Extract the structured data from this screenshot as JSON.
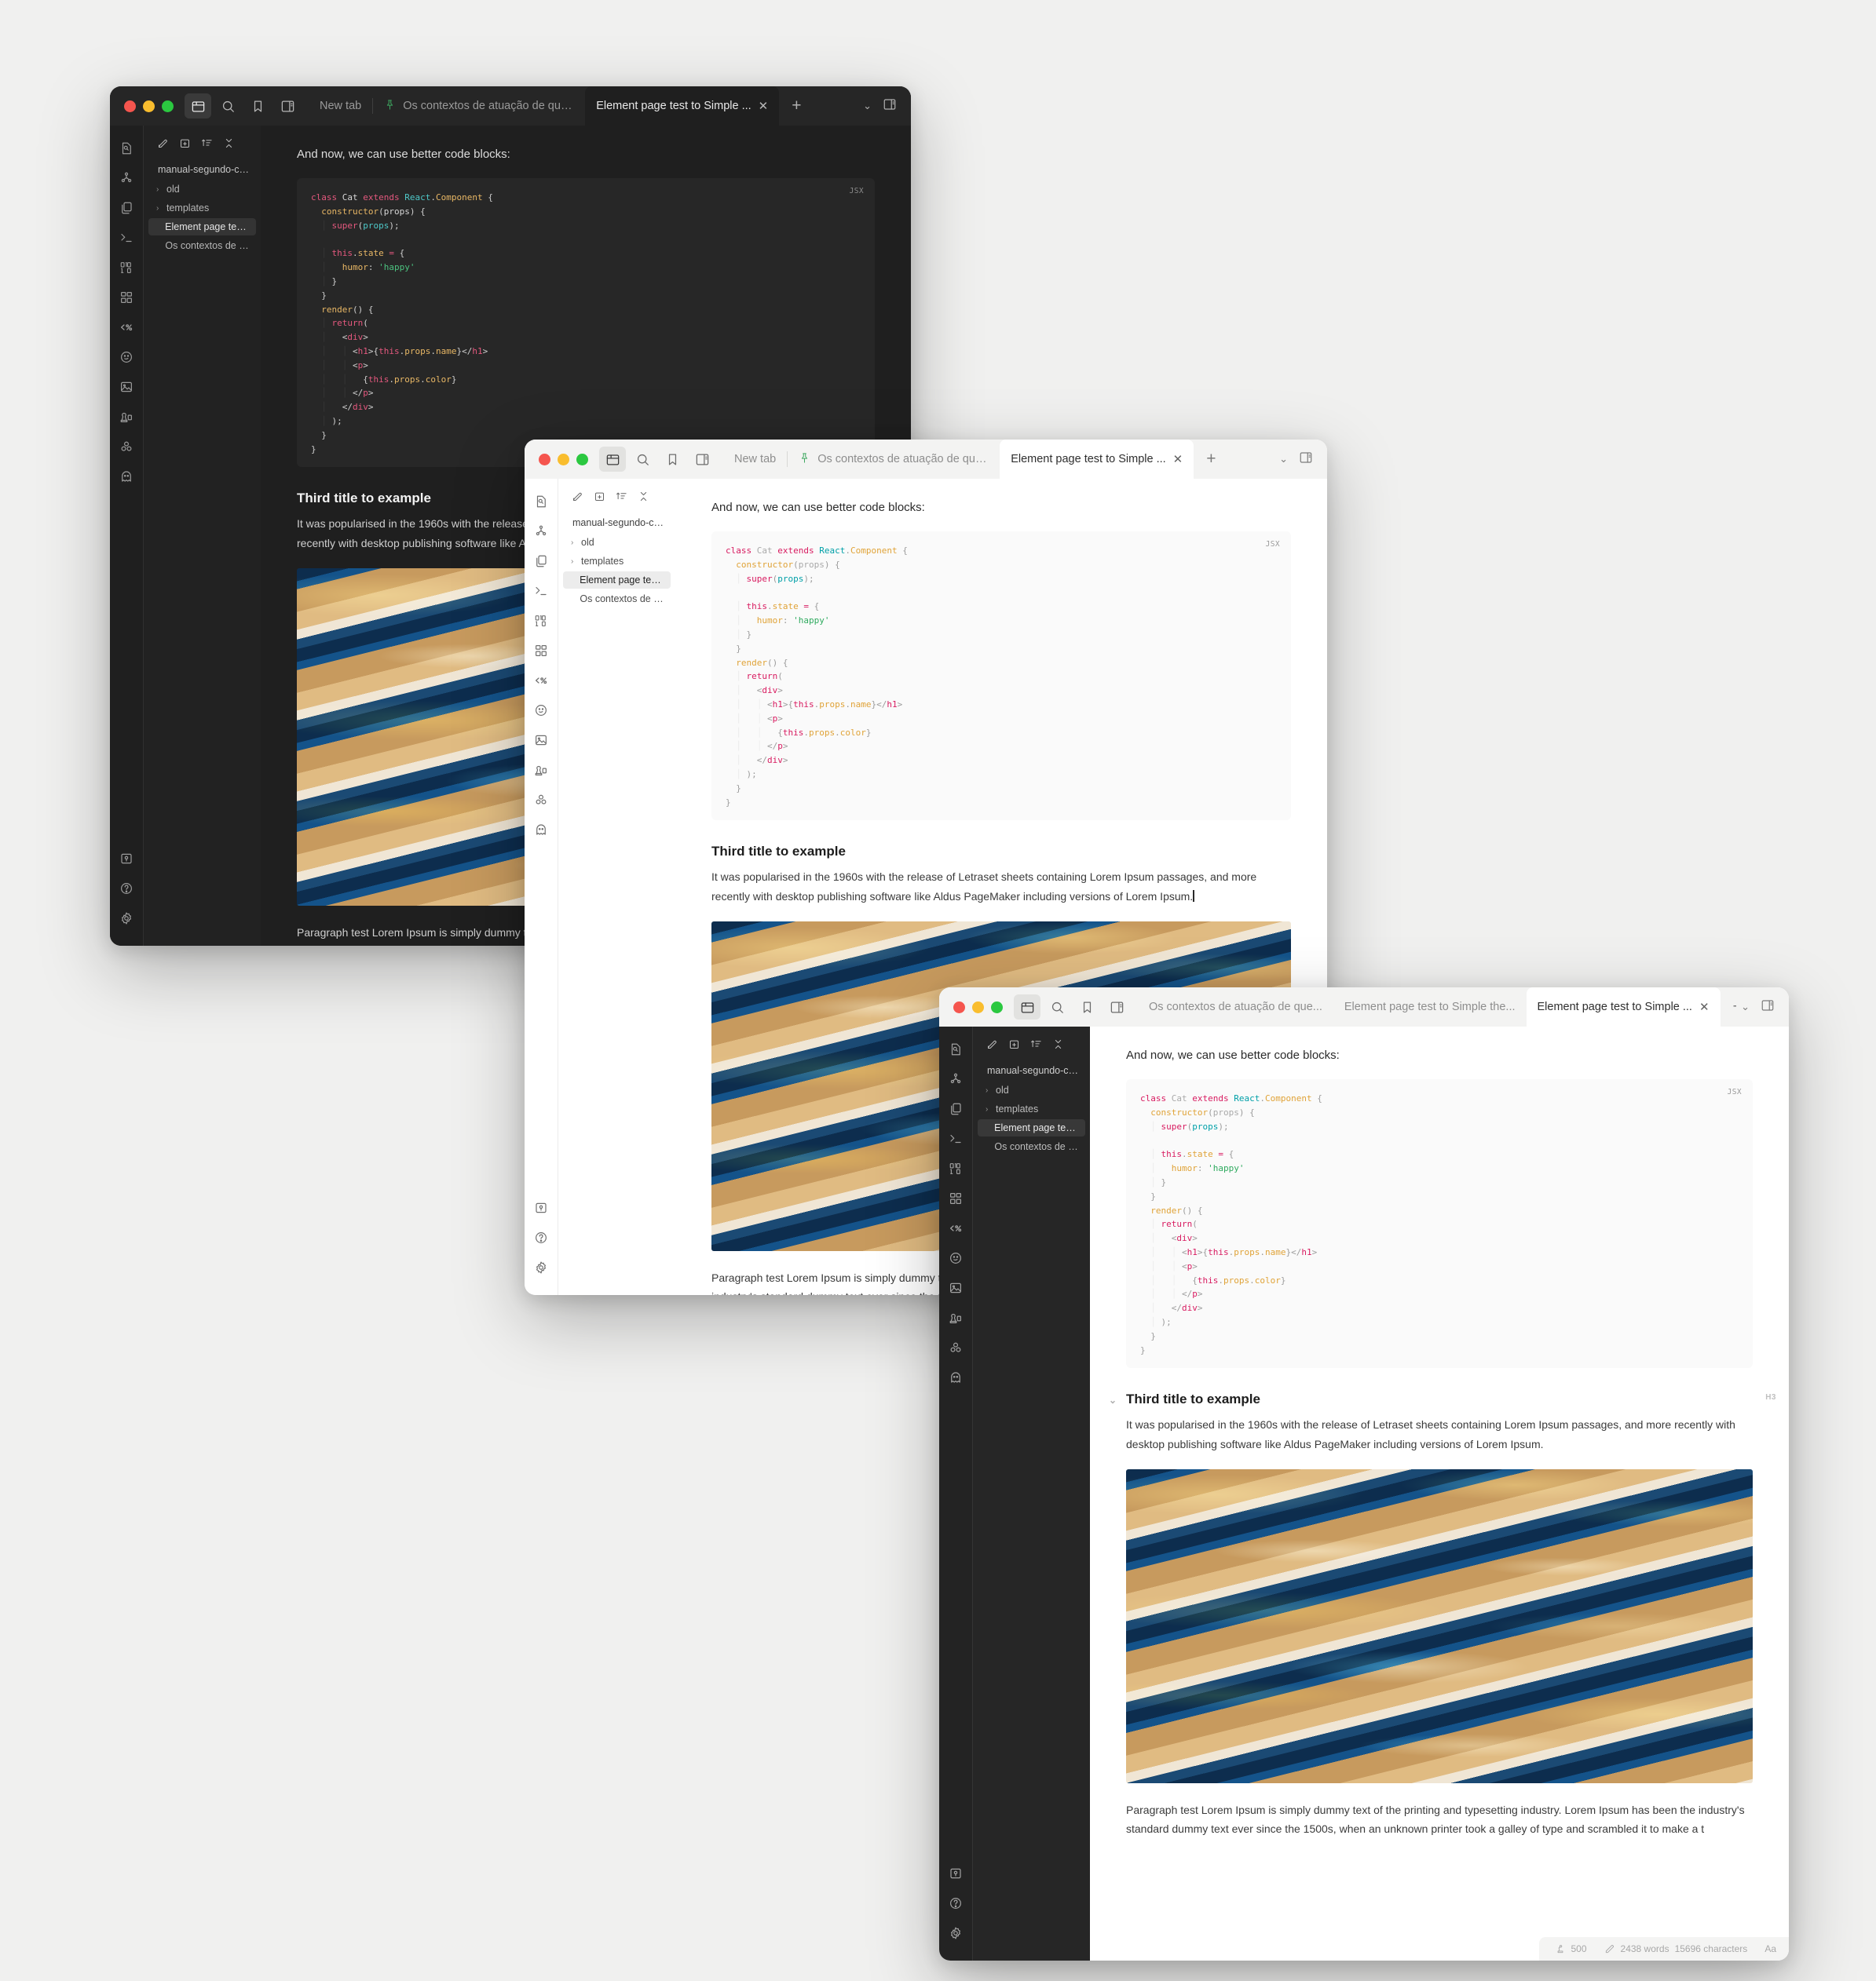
{
  "app": {
    "code_lang_badge": "JSX",
    "intro_text": "And now, we can use better code blocks:",
    "heading": "Third title to example",
    "paragraph_1": "It was popularised in the 1960s with the release of Letraset sheets containing Lorem Ipsum passages, and more recently with desktop publishing software like Aldus PageMaker including versions of Lorem Ipsum.",
    "paragraph_2": "Paragraph test Lorem Ipsum is simply dummy text of the printing and typesetting industry. Lorem Ipsum has been the industry's standard dummy text ever since the 1500s, when an unknown printer took a galley of type and scrambled it to make a t",
    "heading_tag": "H3"
  },
  "code": {
    "lines": [
      [
        {
          "t": "class ",
          "c": "t-kw"
        },
        {
          "t": "Cat ",
          "c": "t-cls"
        },
        {
          "t": "extends ",
          "c": "t-kw"
        },
        {
          "t": "React",
          "c": "t-typ"
        },
        {
          "t": ".",
          "c": "t-pl"
        },
        {
          "t": "Component",
          "c": "t-prop"
        },
        {
          "t": " {",
          "c": "t-pl"
        }
      ],
      [
        {
          "t": "  ",
          "c": "t-pl"
        },
        {
          "t": "constructor",
          "c": "t-fn"
        },
        {
          "t": "(",
          "c": "t-pl"
        },
        {
          "t": "props",
          "c": "t-cls"
        },
        {
          "t": ") {",
          "c": "t-pl"
        }
      ],
      [
        {
          "t": "  ",
          "c": "t-pl"
        },
        {
          "t": "│",
          "c": "gb"
        },
        {
          "t": " ",
          "c": "t-pl"
        },
        {
          "t": "super",
          "c": "t-kw"
        },
        {
          "t": "(",
          "c": "t-pl"
        },
        {
          "t": "props",
          "c": "t-var"
        },
        {
          "t": ");",
          "c": "t-pl"
        }
      ],
      [
        {
          "t": "",
          "c": "t-pl"
        }
      ],
      [
        {
          "t": "  ",
          "c": "t-pl"
        },
        {
          "t": "│",
          "c": "gb"
        },
        {
          "t": " ",
          "c": "t-pl"
        },
        {
          "t": "this",
          "c": "t-kw"
        },
        {
          "t": ".",
          "c": "t-pl"
        },
        {
          "t": "state",
          "c": "t-prop"
        },
        {
          "t": " ",
          "c": "t-pl"
        },
        {
          "t": "=",
          "c": "t-kw"
        },
        {
          "t": " {",
          "c": "t-pl"
        }
      ],
      [
        {
          "t": "  ",
          "c": "t-pl"
        },
        {
          "t": "│",
          "c": "gb"
        },
        {
          "t": "   ",
          "c": "t-pl"
        },
        {
          "t": "humor",
          "c": "t-prop"
        },
        {
          "t": ": ",
          "c": "t-pl"
        },
        {
          "t": "'happy'",
          "c": "t-str"
        }
      ],
      [
        {
          "t": "  ",
          "c": "t-pl"
        },
        {
          "t": "│",
          "c": "gb"
        },
        {
          "t": " }",
          "c": "t-pl"
        }
      ],
      [
        {
          "t": "  }",
          "c": "t-pl"
        }
      ],
      [
        {
          "t": "  ",
          "c": "t-pl"
        },
        {
          "t": "render",
          "c": "t-fn"
        },
        {
          "t": "() {",
          "c": "t-pl"
        }
      ],
      [
        {
          "t": "  ",
          "c": "t-pl"
        },
        {
          "t": "│",
          "c": "gb"
        },
        {
          "t": " ",
          "c": "t-pl"
        },
        {
          "t": "return",
          "c": "t-kw"
        },
        {
          "t": "(",
          "c": "t-pl"
        }
      ],
      [
        {
          "t": "  ",
          "c": "t-pl"
        },
        {
          "t": "│",
          "c": "gb"
        },
        {
          "t": "   <",
          "c": "t-pl"
        },
        {
          "t": "div",
          "c": "t-tag"
        },
        {
          "t": ">",
          "c": "t-pl"
        }
      ],
      [
        {
          "t": "  ",
          "c": "t-pl"
        },
        {
          "t": "│",
          "c": "gb"
        },
        {
          "t": "   ",
          "c": "t-pl"
        },
        {
          "t": "│",
          "c": "gb"
        },
        {
          "t": " <",
          "c": "t-pl"
        },
        {
          "t": "h1",
          "c": "t-tag"
        },
        {
          "t": ">{",
          "c": "t-pl"
        },
        {
          "t": "this",
          "c": "t-kw"
        },
        {
          "t": ".",
          "c": "t-pl"
        },
        {
          "t": "props",
          "c": "t-prop"
        },
        {
          "t": ".",
          "c": "t-pl"
        },
        {
          "t": "name",
          "c": "t-prop"
        },
        {
          "t": "}</",
          "c": "t-pl"
        },
        {
          "t": "h1",
          "c": "t-tag"
        },
        {
          "t": ">",
          "c": "t-pl"
        }
      ],
      [
        {
          "t": "  ",
          "c": "t-pl"
        },
        {
          "t": "│",
          "c": "gb"
        },
        {
          "t": "   ",
          "c": "t-pl"
        },
        {
          "t": "│",
          "c": "gb"
        },
        {
          "t": " <",
          "c": "t-pl"
        },
        {
          "t": "p",
          "c": "t-tag"
        },
        {
          "t": ">",
          "c": "t-pl"
        }
      ],
      [
        {
          "t": "  ",
          "c": "t-pl"
        },
        {
          "t": "│",
          "c": "gb"
        },
        {
          "t": "   ",
          "c": "t-pl"
        },
        {
          "t": "│",
          "c": "gb"
        },
        {
          "t": "   {",
          "c": "t-pl"
        },
        {
          "t": "this",
          "c": "t-kw"
        },
        {
          "t": ".",
          "c": "t-pl"
        },
        {
          "t": "props",
          "c": "t-prop"
        },
        {
          "t": ".",
          "c": "t-pl"
        },
        {
          "t": "color",
          "c": "t-prop"
        },
        {
          "t": "}",
          "c": "t-pl"
        }
      ],
      [
        {
          "t": "  ",
          "c": "t-pl"
        },
        {
          "t": "│",
          "c": "gb"
        },
        {
          "t": "   ",
          "c": "t-pl"
        },
        {
          "t": "│",
          "c": "gb"
        },
        {
          "t": " </",
          "c": "t-pl"
        },
        {
          "t": "p",
          "c": "t-tag"
        },
        {
          "t": ">",
          "c": "t-pl"
        }
      ],
      [
        {
          "t": "  ",
          "c": "t-pl"
        },
        {
          "t": "│",
          "c": "gb"
        },
        {
          "t": "   </",
          "c": "t-pl"
        },
        {
          "t": "div",
          "c": "t-tag"
        },
        {
          "t": ">",
          "c": "t-pl"
        }
      ],
      [
        {
          "t": "  ",
          "c": "t-pl"
        },
        {
          "t": "│",
          "c": "gb"
        },
        {
          "t": " );",
          "c": "t-pl"
        }
      ],
      [
        {
          "t": "  }",
          "c": "t-pl"
        }
      ],
      [
        {
          "t": "}",
          "c": "t-pl"
        }
      ]
    ]
  },
  "sidebar": {
    "rail_icons": [
      "file-search-icon",
      "graph-icon",
      "copy-icon",
      "terminal-icon",
      "binary-icon",
      "grid-icon",
      "code-percent-icon",
      "smiley-icon",
      "image-icon",
      "stamp-icon",
      "blocks-icon",
      "ghost-icon"
    ],
    "rail_bottom_icons": [
      "vault-key-icon",
      "help-icon",
      "settings-icon"
    ],
    "toolbar_icons": [
      "new-note-icon",
      "new-folder-icon",
      "sort-icon",
      "collapse-icon"
    ],
    "root": "manual-segundo-cereb...",
    "items": [
      {
        "label": "old",
        "expandable": true,
        "selected": false
      },
      {
        "label": "templates",
        "expandable": true,
        "selected": false
      },
      {
        "label": "Element page test to Si...",
        "expandable": false,
        "selected": true
      },
      {
        "label": "Os contextos de atuaç...",
        "expandable": false,
        "selected": false
      }
    ]
  },
  "titlebar_icons": [
    "folder-icon",
    "search-icon",
    "bookmark-icon",
    "panel-icon"
  ],
  "windows": [
    {
      "id": "win1",
      "theme": "dark",
      "tabs": [
        {
          "label": "New tab",
          "active": false,
          "pinned": false,
          "closable": false
        },
        {
          "label": "Os contextos de atuação de que...",
          "active": false,
          "pinned": true,
          "closable": false
        },
        {
          "label": "Element page test to Simple ...",
          "active": true,
          "pinned": false,
          "closable": true
        }
      ]
    },
    {
      "id": "win2",
      "theme": "light",
      "tabs": [
        {
          "label": "New tab",
          "active": false,
          "pinned": false,
          "closable": false
        },
        {
          "label": "Os contextos de atuação de que...",
          "active": false,
          "pinned": true,
          "closable": false
        },
        {
          "label": "Element page test to Simple ...",
          "active": true,
          "pinned": false,
          "closable": true
        }
      ]
    },
    {
      "id": "win3",
      "theme": "mixed",
      "tabs": [
        {
          "label": "Os contextos de atuação de que...",
          "active": false,
          "pinned": false,
          "closable": false
        },
        {
          "label": "Element page test to Simple the...",
          "active": false,
          "pinned": false,
          "closable": false
        },
        {
          "label": "Element page test to Simple ...",
          "active": true,
          "pinned": false,
          "closable": true
        }
      ]
    }
  ],
  "statusbar": {
    "backlinks_count": "500",
    "words": "2438 words",
    "characters": "15696 characters",
    "font_label": "Aa"
  },
  "tab_close_glyph": "✕",
  "new_tab_glyph": "+",
  "chevron_down_glyph": "⌄",
  "tree_arrow_glyph": "›"
}
